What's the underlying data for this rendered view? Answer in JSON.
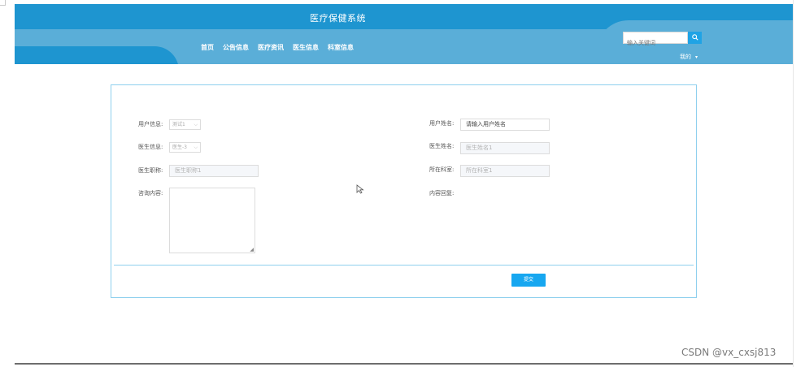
{
  "header": {
    "title": "医疗保健系统",
    "nav": [
      "首页",
      "公告信息",
      "医疗资讯",
      "医生信息",
      "科室信息"
    ],
    "search_placeholder": "输入关键词",
    "search_icon": "search-icon",
    "user_menu": "我的",
    "user_menu_icon": "chevron-down-icon"
  },
  "form": {
    "user_info": {
      "label": "用户信息:",
      "value": "测试1"
    },
    "user_name": {
      "label": "用户姓名:",
      "value": "请输入用户姓名"
    },
    "doctor_info": {
      "label": "医生信息:",
      "value": "医生-3"
    },
    "doctor_name": {
      "label": "医生姓名:",
      "value": "医生姓名1"
    },
    "doctor_title": {
      "label": "医生职称:",
      "value": "医生职称1"
    },
    "department": {
      "label": "所在科室:",
      "value": "所在科室1"
    },
    "consult_content": {
      "label": "咨询内容:",
      "value": ""
    },
    "reply": {
      "label": "内容回复:",
      "value": ""
    },
    "submit_label": "提交"
  },
  "watermark": "CSDN @vx_cxsj813",
  "colors": {
    "header_blue": "#1e95d0",
    "header_wave": "#5aaed8",
    "accent": "#17a7f0",
    "card_border": "#8fd0ee"
  }
}
